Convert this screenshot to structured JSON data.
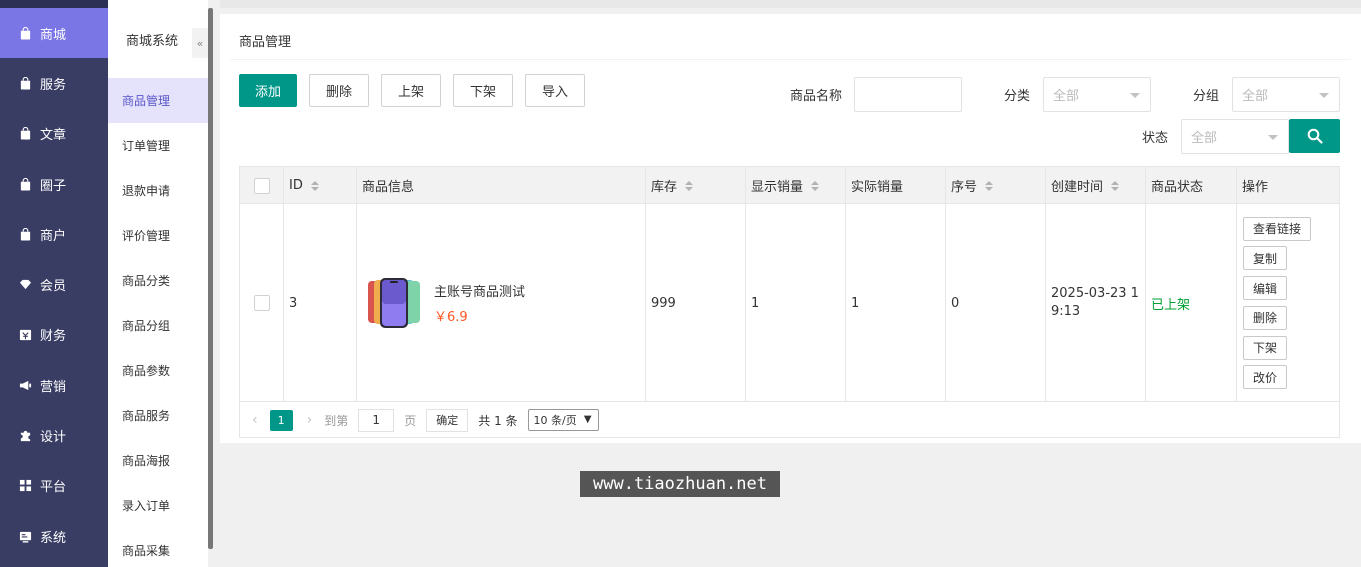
{
  "nav_primary": [
    {
      "label": "商城",
      "icon": "bag-icon",
      "active": true
    },
    {
      "label": "服务",
      "icon": "bag-icon"
    },
    {
      "label": "文章",
      "icon": "bag-icon"
    },
    {
      "label": "圈子",
      "icon": "bag-icon"
    },
    {
      "label": "商户",
      "icon": "bag-icon"
    },
    {
      "label": "会员",
      "icon": "diamond-icon"
    },
    {
      "label": "财务",
      "icon": "finance-icon"
    },
    {
      "label": "营销",
      "icon": "megaphone-icon"
    },
    {
      "label": "设计",
      "icon": "puzzle-icon"
    },
    {
      "label": "平台",
      "icon": "grid-icon"
    },
    {
      "label": "系统",
      "icon": "system-icon"
    }
  ],
  "nav_secondary": {
    "title": "商城系统",
    "collapse_glyph": "«",
    "items": [
      "商品管理",
      "订单管理",
      "退款申请",
      "评价管理",
      "商品分类",
      "商品分组",
      "商品参数",
      "商品服务",
      "商品海报",
      "录入订单",
      "商品采集"
    ]
  },
  "page": {
    "title": "商品管理"
  },
  "toolbar": {
    "add": "添加",
    "delete": "删除",
    "on_shelf": "上架",
    "off_shelf": "下架",
    "import": "导入"
  },
  "filters": {
    "name_label": "商品名称",
    "name_value": "",
    "category_label": "分类",
    "category_value": "全部",
    "group_label": "分组",
    "group_value": "全部",
    "status_label": "状态",
    "status_value": "全部"
  },
  "table": {
    "headers": [
      "ID",
      "商品信息",
      "库存",
      "显示销量",
      "实际销量",
      "序号",
      "创建时间",
      "商品状态",
      "操作"
    ],
    "rows": [
      {
        "id": "3",
        "name": "主账号商品测试",
        "price": "￥6.9",
        "stock": "999",
        "display_sales": "1",
        "actual_sales": "1",
        "order": "0",
        "created": "2025-03-23 19:13",
        "status": "已上架",
        "actions": [
          "查看链接",
          "复制",
          "编辑",
          "删除",
          "下架",
          "改价"
        ]
      }
    ]
  },
  "pagination": {
    "current": "1",
    "goto_label": "到第",
    "goto_value": "1",
    "page_suffix": "页",
    "confirm": "确定",
    "total": "共 1 条",
    "per_page": "10 条/页"
  },
  "watermark": "www.tiaozhuan.net",
  "colors": {
    "nav_bg": "#393d64",
    "nav_active": "#7b76e6",
    "primary": "#009688",
    "price": "#ff5722",
    "status_on": "#009f2f"
  }
}
